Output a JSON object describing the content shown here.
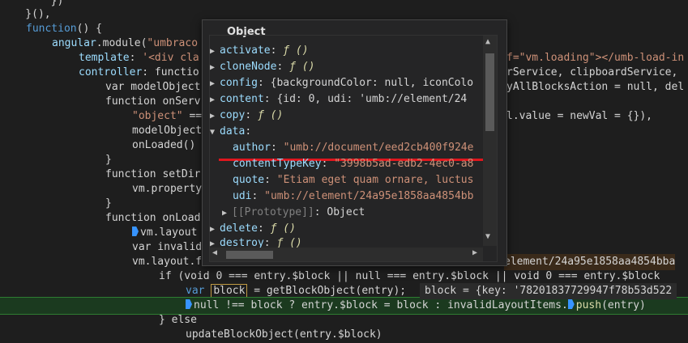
{
  "code": {
    "l0": "        })",
    "l1": "    }(),",
    "l2_kw": "function",
    "l2_rest": "() {",
    "l3_a": "angular",
    "l3_b": ".module(",
    "l3_str": "\"umbraco",
    "l4_key": "template",
    "l4_rest": ": ",
    "l4_str": "'<div cla",
    "l5_key": "controller",
    "l5_rest": ": functio",
    "l6": "var modelObject",
    "l7": "function onServ",
    "l8_str": "\"object\"",
    "l8_rest": " ==",
    "l9": "modelObject",
    "l10": "onLoaded()",
    "l11": "}",
    "l12": "function setDir",
    "l13": "vm.property",
    "l14": "}",
    "l15": "function onLoad",
    "l16": "vm.layout",
    "l17": "var invalid",
    "l18": "vm.layout.f",
    "l19": "if (void 0 === entry.$block || null === entry.$block || void 0 === entry.$block",
    "l20_a": "var ",
    "l20_b": "block",
    "l20_c": " = getBlockObject(entry);",
    "l21": "null !== block ? entry.$block = block : invalidLayoutItems.",
    "l21_push": "push",
    "l21_end": "(entry)",
    "l22": "} else",
    "l23": "updateBlockObject(entry.$block)",
    "r3": "f=\"vm.loading\"></umb-load-in",
    "r5": "rService, clipboardService,",
    "r6": "yAllBlocksAction = null, del",
    "r8": "l.value = newVal = {}),",
    "r18": "element/24a95e1858aa4854bba"
  },
  "inline_value": "block = {key: '78201837729947f78b53d522",
  "popup": {
    "title": "Object",
    "rows": [
      {
        "key": "activate",
        "value": "ƒ ()"
      },
      {
        "key": "cloneNode",
        "value": "ƒ ()"
      },
      {
        "key": "config",
        "value": "{backgroundColor: null, iconColo"
      },
      {
        "key": "content",
        "value": "{id: 0, udi: 'umb://element/24"
      },
      {
        "key": "copy",
        "value": "ƒ ()"
      },
      {
        "key": "data",
        "value": ""
      },
      {
        "key": "author",
        "value": "\"umb://document/eed2cb400f924e"
      },
      {
        "key": "contentTypeKey",
        "value": "\"3998b5ad-edb2-4ec0-a8"
      },
      {
        "key": "quote",
        "value": "\"Etiam eget quam ornare, luctus"
      },
      {
        "key": "udi",
        "value": "\"umb://element/24a95e1858aa4854bb"
      },
      {
        "key": "[[Prototype]]",
        "value": "Object"
      },
      {
        "key": "delete",
        "value": "ƒ ()"
      },
      {
        "key": "destroy",
        "value": "ƒ ()"
      }
    ]
  },
  "colors": {
    "highlight_row": "#1b3a1f",
    "underline": "#e0161e"
  }
}
